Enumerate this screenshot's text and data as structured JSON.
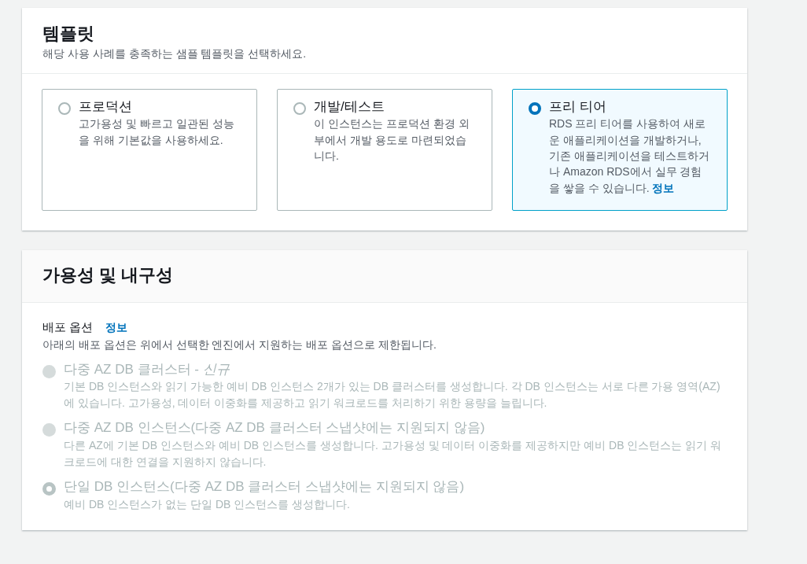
{
  "templates": {
    "title": "템플릿",
    "description": "해당 사용 사례를 충족하는 샘플 템플릿을 선택하세요.",
    "options": [
      {
        "label": "프로덕션",
        "description": "고가용성 및 빠르고 일관된 성능을 위해 기본값을 사용하세요.",
        "selected": false
      },
      {
        "label": "개발/테스트",
        "description": "이 인스턴스는 프로덕션 환경 외부에서 개발 용도로 마련되었습니다.",
        "selected": false
      },
      {
        "label": "프리 티어",
        "description": "RDS 프리 티어를 사용하여 새로운 애플리케이션을 개발하거나, 기존 애플리케이션을 테스트하거나 Amazon RDS에서 실무 경험을 쌓을 수 있습니다.",
        "info_link": "정보",
        "selected": true
      }
    ]
  },
  "availability": {
    "title": "가용성 및 내구성",
    "deployment": {
      "label": "배포 옵션",
      "info_link": "정보",
      "description": "아래의 배포 옵션은 위에서 선택한 엔진에서 지원하는 배포 옵션으로 제한됩니다.",
      "options": [
        {
          "label": "다중 AZ DB 클러스터 - *신규*",
          "description": "기본 DB 인스턴스와 읽기 가능한 예비 DB 인스턴스 2개가 있는 DB 클러스터를 생성합니다. 각 DB 인스턴스는 서로 다른 가용 영역(AZ)에 있습니다. 고가용성, 데이터 이중화를 제공하고 읽기 워크로드를 처리하기 위한 용량을 늘립니다.",
          "selected": false,
          "disabled": true
        },
        {
          "label": "다중 AZ DB 인스턴스(다중 AZ DB 클러스터 스냅샷에는 지원되지 않음)",
          "description": "다른 AZ에 기본 DB 인스턴스와 예비 DB 인스턴스를 생성합니다. 고가용성 및 데이터 이중화를 제공하지만 예비 DB 인스턴스는 읽기 워크로드에 대한 연결을 지원하지 않습니다.",
          "selected": false,
          "disabled": true
        },
        {
          "label": "단일 DB 인스턴스(다중 AZ DB 클러스터 스냅샷에는 지원되지 않음)",
          "description": "예비 DB 인스턴스가 없는 단일 DB 인스턴스를 생성합니다.",
          "selected": true,
          "disabled": true
        }
      ]
    }
  }
}
